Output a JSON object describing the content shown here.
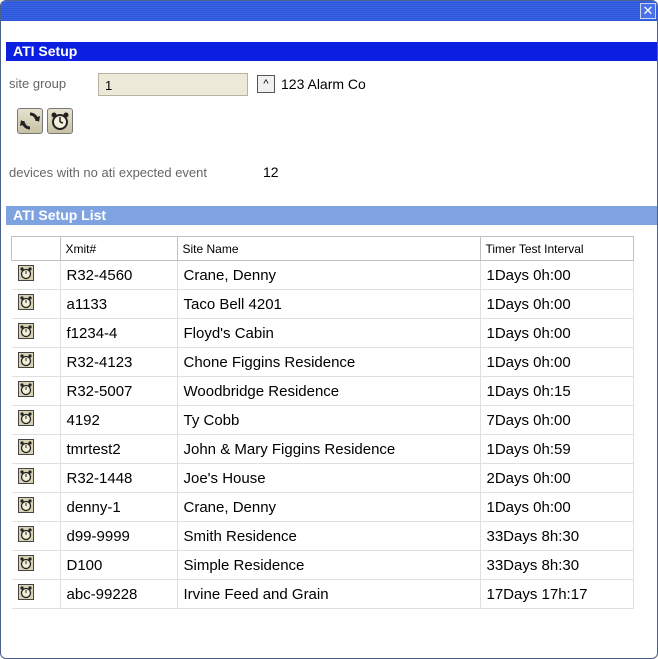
{
  "window": {
    "close_glyph": "✕"
  },
  "setup": {
    "title": "ATI Setup",
    "site_group_label": "site group",
    "site_group_value": "1",
    "spin_glyph": "^",
    "site_group_name": "123 Alarm Co",
    "devices_label": "devices with no ati expected event",
    "devices_count": "12"
  },
  "list": {
    "title": "ATI Setup List",
    "columns": [
      "",
      "Xmit#",
      "Site Name",
      "Timer Test Interval"
    ],
    "rows": [
      {
        "xmit": "R32-4560",
        "site": "Crane, Denny",
        "interval": "1Days 0h:00"
      },
      {
        "xmit": "a1133",
        "site": "Taco Bell 4201",
        "interval": "1Days 0h:00"
      },
      {
        "xmit": "f1234-4",
        "site": "Floyd's Cabin",
        "interval": "1Days 0h:00"
      },
      {
        "xmit": "R32-4123",
        "site": "Chone Figgins Residence",
        "interval": "1Days 0h:00"
      },
      {
        "xmit": "R32-5007",
        "site": "Woodbridge Residence",
        "interval": "1Days 0h:15"
      },
      {
        "xmit": "4192",
        "site": "Ty Cobb",
        "interval": "7Days 0h:00"
      },
      {
        "xmit": "tmrtest2",
        "site": "John & Mary Figgins Residence",
        "interval": "1Days 0h:59"
      },
      {
        "xmit": "R32-1448",
        "site": "Joe's House",
        "interval": "2Days 0h:00"
      },
      {
        "xmit": "denny-1",
        "site": "Crane, Denny",
        "interval": "1Days 0h:00"
      },
      {
        "xmit": "d99-9999",
        "site": "Smith Residence",
        "interval": "33Days 8h:30"
      },
      {
        "xmit": "D100",
        "site": "Simple Residence",
        "interval": "33Days 8h:30"
      },
      {
        "xmit": "abc-99228",
        "site": "Irvine Feed and Grain",
        "interval": "17Days 17h:17"
      }
    ]
  },
  "icons": {
    "refresh": "refresh-icon",
    "alarm": "alarm-clock-icon"
  },
  "colors": {
    "section_bar": "#0b1fe0",
    "list_bar": "#7fa2e0",
    "titlebar": "#2d55d8"
  }
}
